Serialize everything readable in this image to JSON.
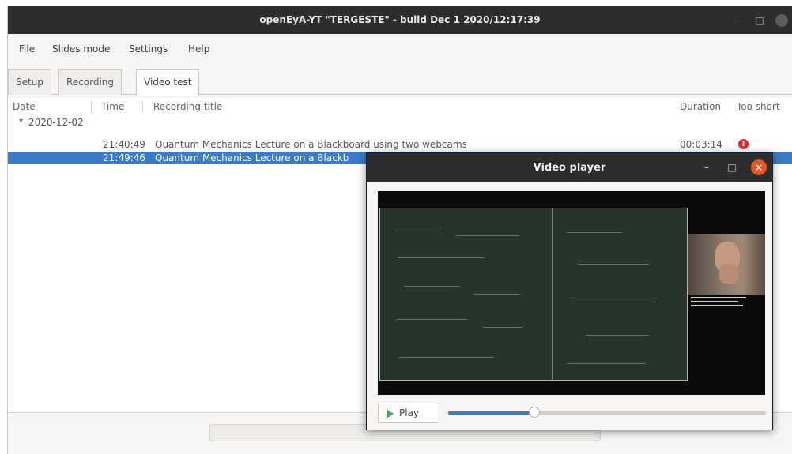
{
  "window": {
    "title": "openEyA-YT \"TERGESTE\" - build Dec  1 2020/12:17:39",
    "minimize_glyph": "–",
    "maximize_glyph": "□",
    "close_glyph": "●"
  },
  "menu": [
    {
      "label": "File"
    },
    {
      "label": "Slides mode"
    },
    {
      "label": "Settings"
    },
    {
      "label": "Help"
    }
  ],
  "tabs": [
    {
      "label": "Setup",
      "active": false
    },
    {
      "label": "Recording",
      "active": false
    },
    {
      "label": "Video test",
      "active": true
    }
  ],
  "recordings_table": {
    "columns": [
      "Date",
      "Time",
      "Recording title",
      "Duration",
      "Too short"
    ],
    "group": {
      "expander": "▾",
      "date": "2020-12-02"
    },
    "rows": [
      {
        "time": "21:40:49",
        "title": "Quantum Mechanics Lecture on a Blackboard using two webcams",
        "duration": "00:03:14",
        "too_short_icon": "error-icon",
        "selected": false
      },
      {
        "time": "21:49:46",
        "title": "Quantum Mechanics Lecture on a Blackb",
        "duration": "",
        "too_short_icon": "",
        "selected": true
      }
    ]
  },
  "error_icon_glyph": "!",
  "video_player": {
    "title": "Video player",
    "minimize_glyph": "–",
    "maximize_glyph": "□",
    "close_glyph": "×",
    "play_label": "Play",
    "progress": 0.27
  },
  "colors": {
    "selection": "#3a7cc8",
    "titlebar": "#2d2d2d",
    "close_button": "#e95420",
    "error": "#e0282c",
    "play_icon": "#48a848"
  }
}
